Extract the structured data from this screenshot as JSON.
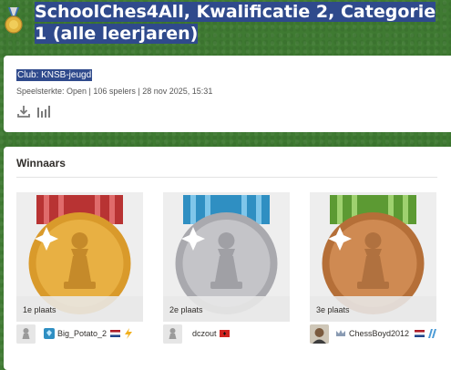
{
  "title": "SchoolChes4All, Kwalificatie 2, Categorie 1 (alle leerjaren)",
  "club": "Club: KNSB-jeugd",
  "meta": "Speelsterkte: Open | 106 spelers | 28 nov 2025, 15:31",
  "icons": {
    "title": "medal-icon",
    "download": "download-icon",
    "stats": "bar-chart-icon"
  },
  "winners": {
    "heading": "Winnaars",
    "places": [
      {
        "label": "1e plaats",
        "medal": "gold",
        "ribbon": "#c63a3a",
        "color": "#e3a33d",
        "player": "Big_Potato_2",
        "badge": "diamond-icon",
        "flag": "nl-flag-icon",
        "extra": "lightning-icon"
      },
      {
        "label": "2e plaats",
        "medal": "silver",
        "ribbon": "#3ba3d8",
        "color": "#bfbfc4",
        "player": "dczout",
        "badge": "",
        "flag": "al-flag-icon",
        "extra": ""
      },
      {
        "label": "3e plaats",
        "medal": "bronze",
        "ribbon": "#6aa83a",
        "color": "#c9824b",
        "player": "ChessBoyd2012",
        "badge": "crown-icon",
        "flag": "nl-flag-icon",
        "extra": "stripes-icon"
      }
    ]
  }
}
